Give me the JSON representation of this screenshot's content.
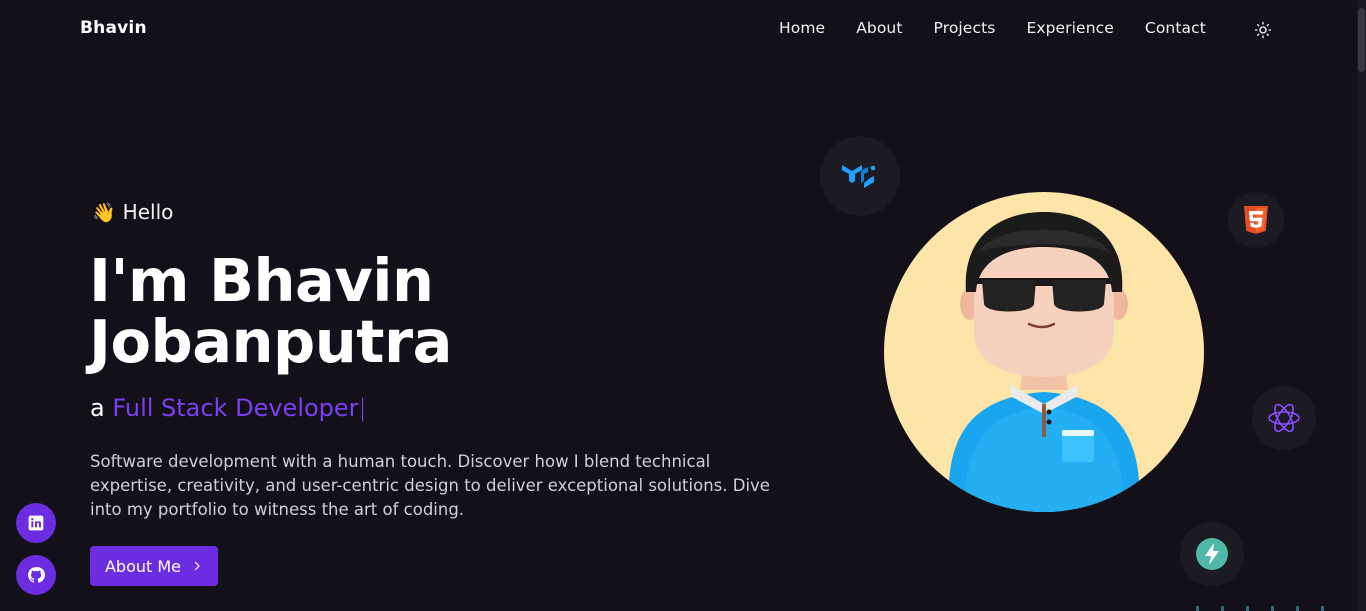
{
  "header": {
    "brand": "Bhavin",
    "nav": [
      "Home",
      "About",
      "Projects",
      "Experience",
      "Contact"
    ],
    "theme_icon": "sun-icon"
  },
  "hero": {
    "greeting_emoji": "👋",
    "greeting": "Hello",
    "title_line1": "I'm Bhavin",
    "title_line2": "Jobanputra",
    "role_prefix": "a",
    "role": "Full Stack Developer",
    "cursor": "|",
    "description": "Software development with a human touch. Discover how I blend technical expertise, creativity, and user-centric design to deliver exceptional solutions. Dive into my portfolio to witness the art of coding.",
    "cta_label": "About Me",
    "cta_icon": "chevron-right-icon"
  },
  "social": [
    {
      "name": "linkedin-icon"
    },
    {
      "name": "github-icon"
    }
  ],
  "tech_icons": [
    "material-ui-icon",
    "html5-icon",
    "graphql-icon",
    "bolt-icon"
  ],
  "colors": {
    "background": "#131019",
    "accent": "#7b3ff2",
    "button": "#6a2ee0",
    "avatar_bg": "#fde4a8"
  }
}
